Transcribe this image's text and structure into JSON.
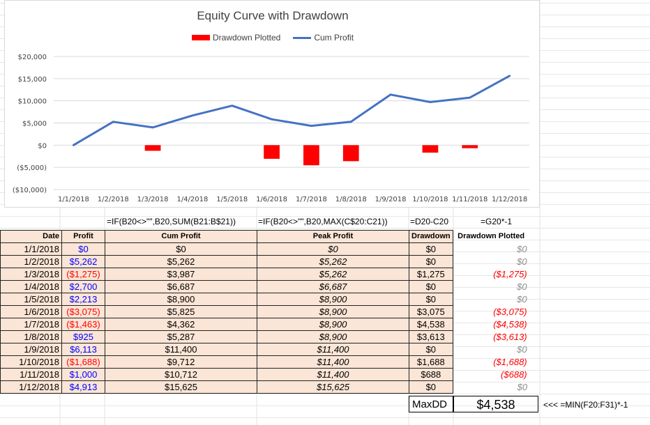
{
  "chart_data": {
    "type": "bar",
    "title": "Equity Curve with Drawdown",
    "categories": [
      "1/1/2018",
      "1/2/2018",
      "1/3/2018",
      "1/4/2018",
      "1/5/2018",
      "1/6/2018",
      "1/7/2018",
      "1/8/2018",
      "1/9/2018",
      "1/10/2018",
      "1/11/2018",
      "1/12/2018"
    ],
    "series": [
      {
        "name": "Drawdown Plotted",
        "type": "bar",
        "color": "#ff0000",
        "values": [
          0,
          0,
          -1275,
          0,
          0,
          -3075,
          -4538,
          -3613,
          0,
          -1688,
          -688,
          0
        ]
      },
      {
        "name": "Cum Profit",
        "type": "line",
        "color": "#4472c4",
        "values": [
          0,
          5262,
          3987,
          6687,
          8900,
          5825,
          4362,
          5287,
          11400,
          9712,
          10712,
          15625
        ]
      }
    ],
    "ylim": [
      -10000,
      20000
    ],
    "yticks": [
      20000,
      15000,
      10000,
      5000,
      0,
      -5000,
      -10000
    ],
    "ytick_labels": [
      "$20,000",
      "$15,000",
      "$10,000",
      "$5,000",
      "$0",
      "($5,000)",
      "($10,000)"
    ],
    "legend": "top",
    "grid": true
  },
  "formulas": {
    "cum": "=IF(B20<>\"\",B20,SUM(B21:B$21))",
    "peak": "=IF(B20<>\"\",B20,MAX(C$20:C21))",
    "dd": "=D20-C20",
    "ddp": "=G20*-1"
  },
  "headers": {
    "date": "Date",
    "profit": "Profit",
    "cum": "Cum Profit",
    "peak": "Peak Profit",
    "dd": "Drawdown",
    "ddp": "Drawdown Plotted"
  },
  "rows": [
    {
      "date": "1/1/2018",
      "profit": "$0",
      "cum": "$0",
      "peak": "$0",
      "dd": "$0",
      "ddp": "$0"
    },
    {
      "date": "1/2/2018",
      "profit": "$5,262",
      "cum": "$5,262",
      "peak": "$5,262",
      "dd": "$0",
      "ddp": "$0"
    },
    {
      "date": "1/3/2018",
      "profit": "($1,275)",
      "cum": "$3,987",
      "peak": "$5,262",
      "dd": "$1,275",
      "ddp": "($1,275)"
    },
    {
      "date": "1/4/2018",
      "profit": "$2,700",
      "cum": "$6,687",
      "peak": "$6,687",
      "dd": "$0",
      "ddp": "$0"
    },
    {
      "date": "1/5/2018",
      "profit": "$2,213",
      "cum": "$8,900",
      "peak": "$8,900",
      "dd": "$0",
      "ddp": "$0"
    },
    {
      "date": "1/6/2018",
      "profit": "($3,075)",
      "cum": "$5,825",
      "peak": "$8,900",
      "dd": "$3,075",
      "ddp": "($3,075)"
    },
    {
      "date": "1/7/2018",
      "profit": "($1,463)",
      "cum": "$4,362",
      "peak": "$8,900",
      "dd": "$4,538",
      "ddp": "($4,538)"
    },
    {
      "date": "1/8/2018",
      "profit": "$925",
      "cum": "$5,287",
      "peak": "$8,900",
      "dd": "$3,613",
      "ddp": "($3,613)"
    },
    {
      "date": "1/9/2018",
      "profit": "$6,113",
      "cum": "$11,400",
      "peak": "$11,400",
      "dd": "$0",
      "ddp": "$0"
    },
    {
      "date": "1/10/2018",
      "profit": "($1,688)",
      "cum": "$9,712",
      "peak": "$11,400",
      "dd": "$1,688",
      "ddp": "($1,688)"
    },
    {
      "date": "1/11/2018",
      "profit": "$1,000",
      "cum": "$10,712",
      "peak": "$11,400",
      "dd": "$688",
      "ddp": "($688)"
    },
    {
      "date": "1/12/2018",
      "profit": "$4,913",
      "cum": "$15,625",
      "peak": "$15,625",
      "dd": "$0",
      "ddp": "$0"
    }
  ],
  "maxdd": {
    "label": "MaxDD",
    "value": "$4,538",
    "formula": "<<<  =MIN(F20:F31)*-1"
  }
}
